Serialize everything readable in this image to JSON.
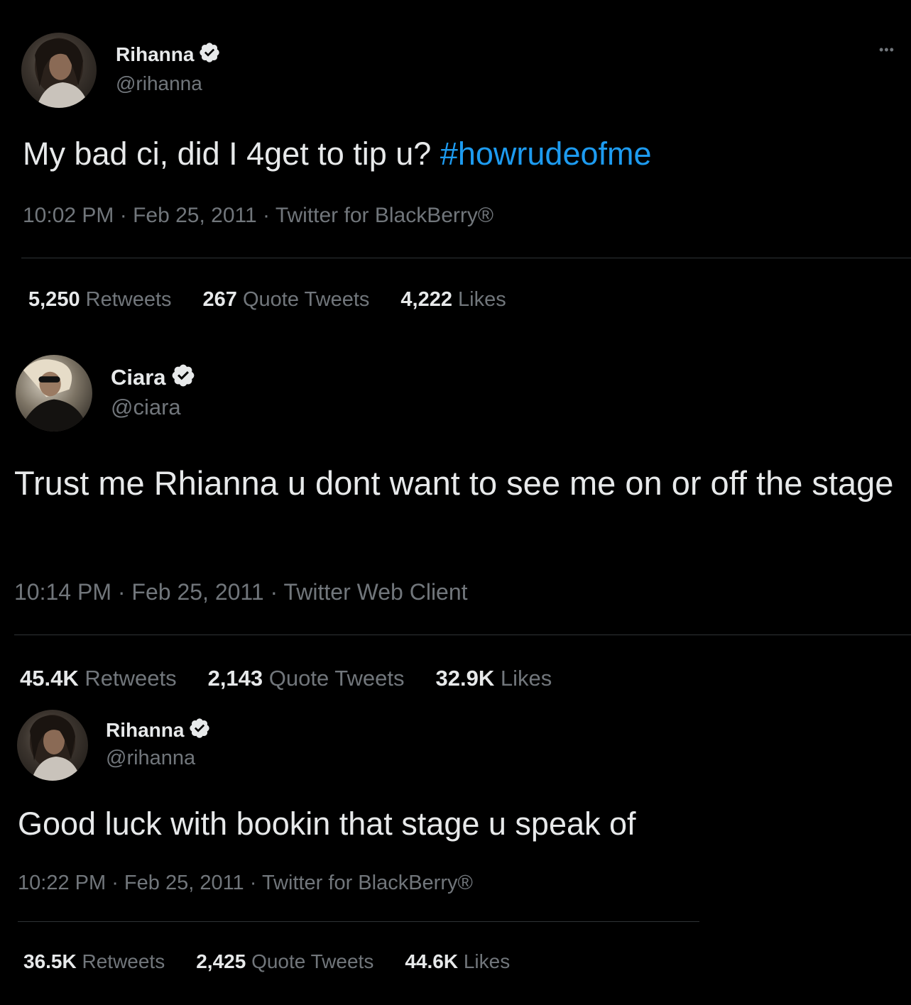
{
  "colors": {
    "background": "#000000",
    "text": "#e7e9ea",
    "muted": "#71767b",
    "link": "#1d9bf0",
    "divider": "#2f3336"
  },
  "icons": {
    "verified": "verified-badge-icon",
    "more": "more-options-icon"
  },
  "more_label": "•••",
  "tweets": [
    {
      "name": "Rihanna",
      "handle": "@rihanna",
      "text": "My bad ci, did I 4get to tip u? ",
      "hashtag": "#howrudeofme",
      "time": "10:02 PM",
      "sep1": " · ",
      "date": "Feb 25, 2011",
      "sep2": " · ",
      "source": "Twitter for BlackBerry®",
      "retweets_count": "5,250",
      "retweets_label": " Retweets",
      "quotes_count": "267",
      "quotes_label": " Quote Tweets",
      "likes_count": "4,222",
      "likes_label": " Likes"
    },
    {
      "name": "Ciara",
      "handle": "@ciara",
      "text": "Trust me Rhianna u dont want to see me on or off the stage",
      "time": "10:14 PM",
      "sep1": " · ",
      "date": "Feb 25, 2011",
      "sep2": " · ",
      "source": "Twitter Web Client",
      "retweets_count": "45.4K",
      "retweets_label": " Retweets",
      "quotes_count": "2,143",
      "quotes_label": " Quote Tweets",
      "likes_count": "32.9K",
      "likes_label": " Likes"
    },
    {
      "name": "Rihanna",
      "handle": "@rihanna",
      "text": "Good luck with bookin that stage u speak of",
      "time": "10:22 PM",
      "sep1": " · ",
      "date": "Feb 25, 2011",
      "sep2": " · ",
      "source": "Twitter for BlackBerry®",
      "retweets_count": "36.5K",
      "retweets_label": " Retweets",
      "quotes_count": "2,425",
      "quotes_label": " Quote Tweets",
      "likes_count": "44.6K",
      "likes_label": " Likes"
    }
  ]
}
